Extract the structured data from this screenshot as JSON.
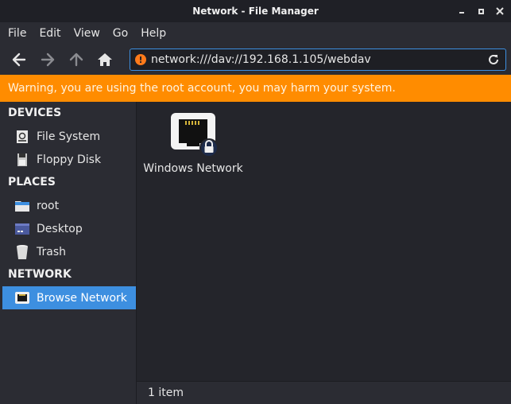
{
  "window": {
    "title": "Network - File Manager"
  },
  "menu": {
    "items": [
      "File",
      "Edit",
      "View",
      "Go",
      "Help"
    ]
  },
  "toolbar": {
    "address_value": "network:///dav://192.168.1.105/webdav"
  },
  "warning": {
    "text": "Warning, you are using the root account, you may harm your system."
  },
  "sidebar": {
    "devices_header": "DEVICES",
    "devices": [
      {
        "label": "File System",
        "icon": "drive-icon"
      },
      {
        "label": "Floppy Disk",
        "icon": "floppy-icon"
      }
    ],
    "places_header": "PLACES",
    "places": [
      {
        "label": "root",
        "icon": "folder-icon"
      },
      {
        "label": "Desktop",
        "icon": "desktop-icon"
      },
      {
        "label": "Trash",
        "icon": "trash-icon"
      }
    ],
    "network_header": "NETWORK",
    "network": [
      {
        "label": "Browse Network",
        "icon": "network-icon",
        "selected": true
      }
    ]
  },
  "content": {
    "items": [
      {
        "label": "Windows Network",
        "icon": "network-share-locked-icon"
      }
    ]
  },
  "status": {
    "text": "1 item"
  },
  "colors": {
    "accent": "#3d8fe0",
    "warning": "#ff8c00"
  }
}
